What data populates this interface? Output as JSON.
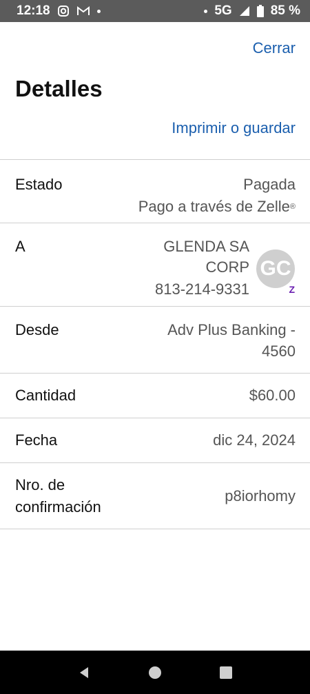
{
  "status_bar": {
    "time": "12:18",
    "network": "5G",
    "battery": "85 %"
  },
  "header": {
    "close_label": "Cerrar",
    "title": "Detalles",
    "print_label": "Imprimir o guardar"
  },
  "details": {
    "estado": {
      "label": "Estado",
      "value": "Pagada",
      "subvalue": "Pago a través de Zelle",
      "sup": "®"
    },
    "a": {
      "label": "A",
      "name_line1": "GLENDA SA",
      "name_line2": "CORP",
      "phone": "813-214-9331",
      "avatar_initials": "GC",
      "badge": "Z"
    },
    "desde": {
      "label": "Desde",
      "value_line1": "Adv Plus Banking -",
      "value_line2": "4560"
    },
    "cantidad": {
      "label": "Cantidad",
      "value": "$60.00"
    },
    "fecha": {
      "label": "Fecha",
      "value": "dic 24, 2024"
    },
    "confirmacion": {
      "label_line1": "Nro. de",
      "label_line2": "confirmación",
      "value": "p8iorhomy"
    }
  }
}
